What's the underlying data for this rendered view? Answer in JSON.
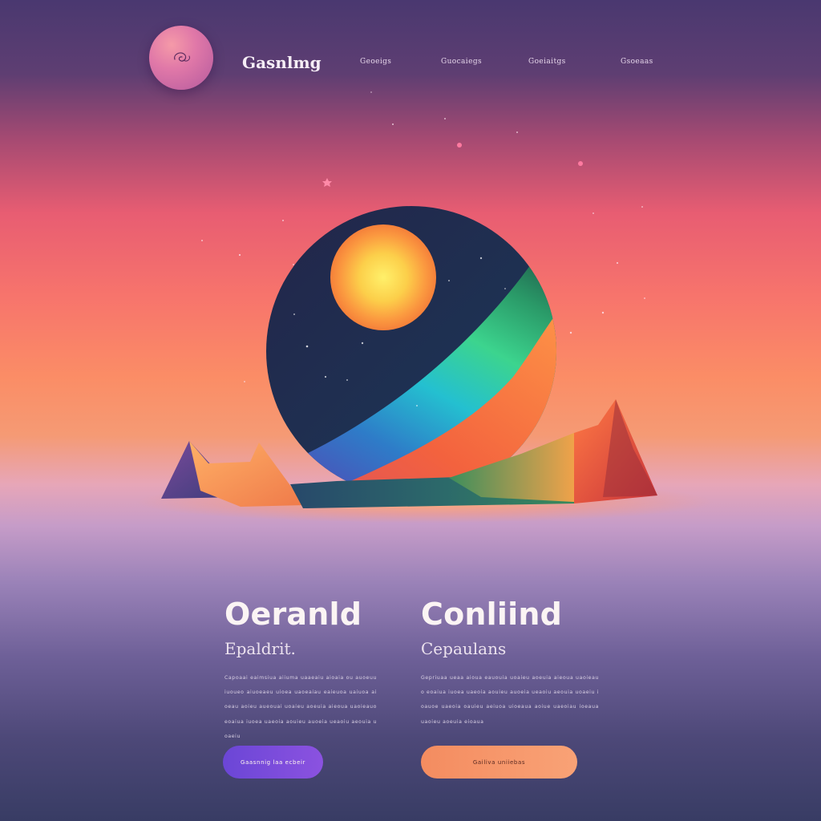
{
  "header": {
    "brand": "Gasnlmg",
    "logo_icon": "swirl-logo-icon",
    "nav": [
      "Geoeigs",
      "Guocaiegs",
      "Goeiaitgs",
      "Gsoeaas"
    ]
  },
  "hero": {
    "illustration": "sunset-sphere-scene"
  },
  "features": [
    {
      "title": "Oeranld",
      "subtitle": "Epaldrit.",
      "body": "Capoaai eaimsiua aiiuma uaaeaiu aioaia ou auoeuu iuoueo aiuoeaeu uioea uaoeaiau eaieuoa uaiuoa aioeau aoieu aueouai uoaieu aoeuia aieoua uaoieauo eoaiua iuoea uaeoia aouieu auoeia ueaoiu aeouia uoaeiu",
      "button": "Gaasnnig laa ecbeir"
    },
    {
      "title": "Conliind",
      "subtitle": "Cepaulans",
      "body": "Gepriuaa ueaa aioua eauouia uoaieu aoeuia aieoua uaoieauo eoaiua iuoea uaeoia aouieu auoeia ueaoiu aeouia uoaeiu ioauoe uaeoia oauieu aeiuoa uioeaua aoiue uaeoiau ioeaua uaoieu aoeuia eioaua",
      "button": "Gailiva uniiebas"
    }
  ],
  "colors": {
    "sky_top": "#4a3870",
    "sunset_coral": "#f7746c",
    "sunset_orange": "#fb8d66",
    "bottom_navy": "#383c64",
    "button_primary": "#7a4cdc",
    "button_secondary": "#f6966a"
  }
}
